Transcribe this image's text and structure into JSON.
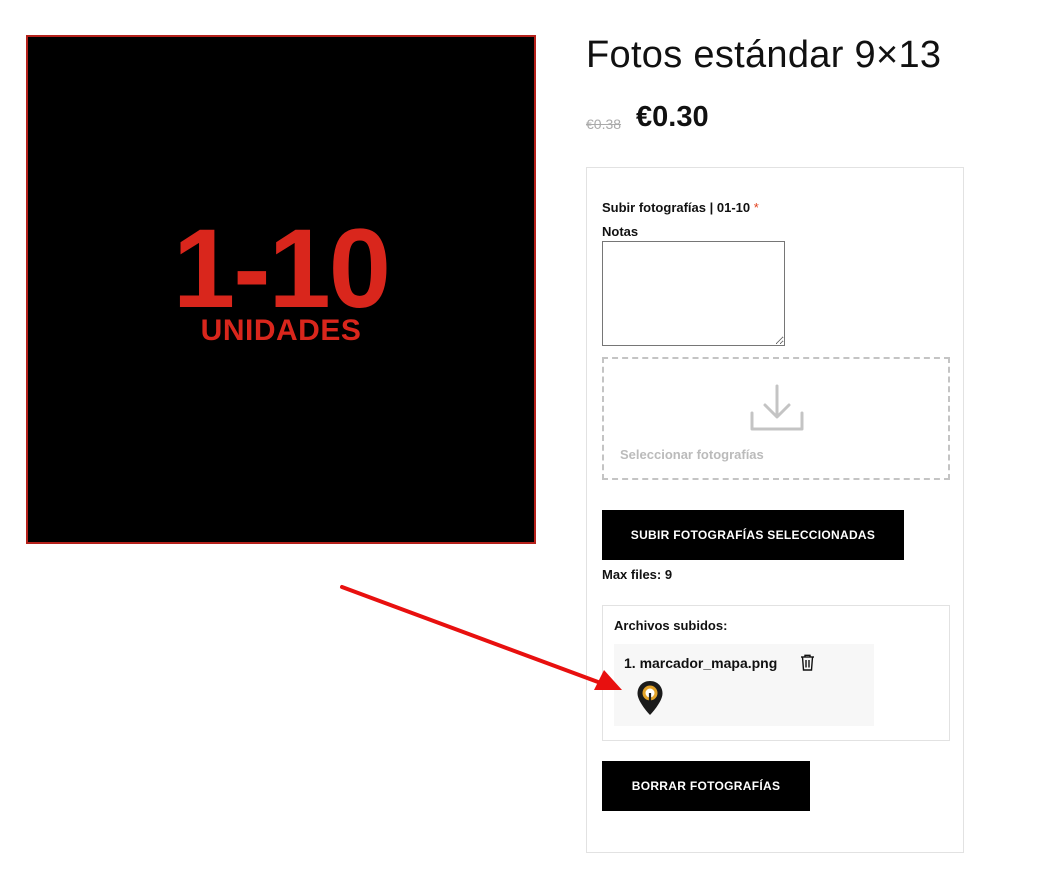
{
  "product": {
    "image": {
      "count_text": "1-10",
      "unit_text": "UNIDADES"
    },
    "title": "Fotos estándar 9×13",
    "price_old": "€0.38",
    "price_new": "€0.30"
  },
  "form": {
    "upload_label": "Subir fotografías | 01-10",
    "required_mark": "*",
    "notes_label": "Notas",
    "notes_value": "",
    "dropzone": {
      "icon": "download-icon",
      "label": "Seleccionar fotografías"
    },
    "upload_button": "SUBIR FOTOGRAFÍAS SELECCIONADAS",
    "max_files": "Max files: 9",
    "uploaded": {
      "heading": "Archivos subidos:",
      "files": [
        {
          "name": "1. marcador_mapa.png",
          "delete_icon": "trash-icon",
          "thumbnail_icon": "map-marker-icon"
        }
      ]
    },
    "delete_button": "BORRAR FOTOGRAFÍAS"
  },
  "colors": {
    "brand_red": "#d9261c",
    "button_bg": "#000000",
    "annotation_arrow": "#e8100f"
  }
}
